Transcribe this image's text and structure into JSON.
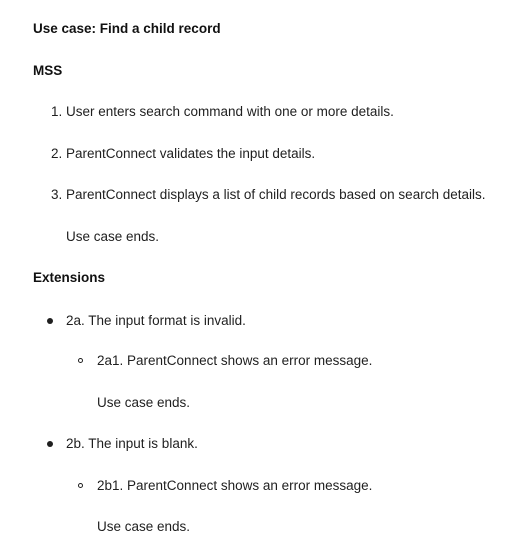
{
  "title": "Use case: Find a child record",
  "mss": {
    "heading": "MSS",
    "steps": [
      {
        "num": "1.",
        "text": "User enters search command with one or more details."
      },
      {
        "num": "2.",
        "text": "ParentConnect validates the input details."
      },
      {
        "num": "3.",
        "text": "ParentConnect displays a list of child records based on search details."
      }
    ],
    "end": "Use case ends."
  },
  "extensions": {
    "heading": "Extensions",
    "items": [
      {
        "text": "2a. The input format is invalid.",
        "sub": {
          "text": "2a1. ParentConnect shows an error message.",
          "end": "Use case ends."
        }
      },
      {
        "text": "2b. The input is blank.",
        "sub": {
          "text": "2b1. ParentConnect shows an error message.",
          "end": "Use case ends."
        }
      }
    ]
  }
}
